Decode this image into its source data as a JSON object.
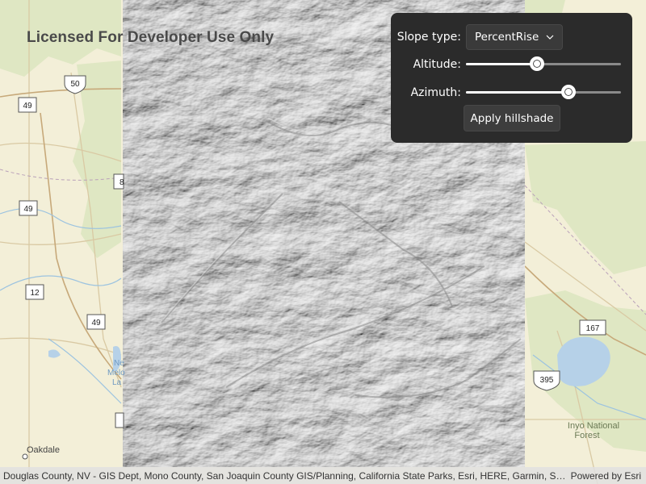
{
  "map": {
    "watermark": "Licensed For Developer Use Only",
    "route_shields": {
      "us_50": "50",
      "ca_49_top": "49",
      "ca_49_mid": "49",
      "ca_12": "12",
      "ca_49_low": "49",
      "us_395": "395",
      "ca_167": "167",
      "partial_shield": "8"
    },
    "place_labels": {
      "oakdale": "Oakdale",
      "inyo_line1": "Inyo National",
      "inyo_line2": "Forest",
      "lake_partial1": "Ne",
      "lake_partial2": "Melo",
      "lake_partial3": "La"
    },
    "colors": {
      "basemap_land": "#f3efd8",
      "forest": "#dfe7c3",
      "hillshade_gray": "#b4b4b4",
      "water": "#b6d1e8",
      "panel_bg": "#2b2b2b"
    }
  },
  "panel": {
    "slope_type_label": "Slope type:",
    "slope_type_value": "PercentRise",
    "altitude_label": "Altitude:",
    "altitude_value": 0.46,
    "azimuth_label": "Azimuth:",
    "azimuth_value": 0.66,
    "apply_label": "Apply hillshade",
    "chevron_icon": "chevron-down-icon"
  },
  "attribution": {
    "text": "Douglas County, NV - GIS Dept, Mono County, San Joaquin County GIS/Planning, California State Parks, Esri, HERE, Garmin, SafeGraph, GeoTechnologies, Inc, METI/NASA, USGS, Bureau of Land Management, EPA, NPS, USDA",
    "powered_by": "Powered by Esri"
  }
}
